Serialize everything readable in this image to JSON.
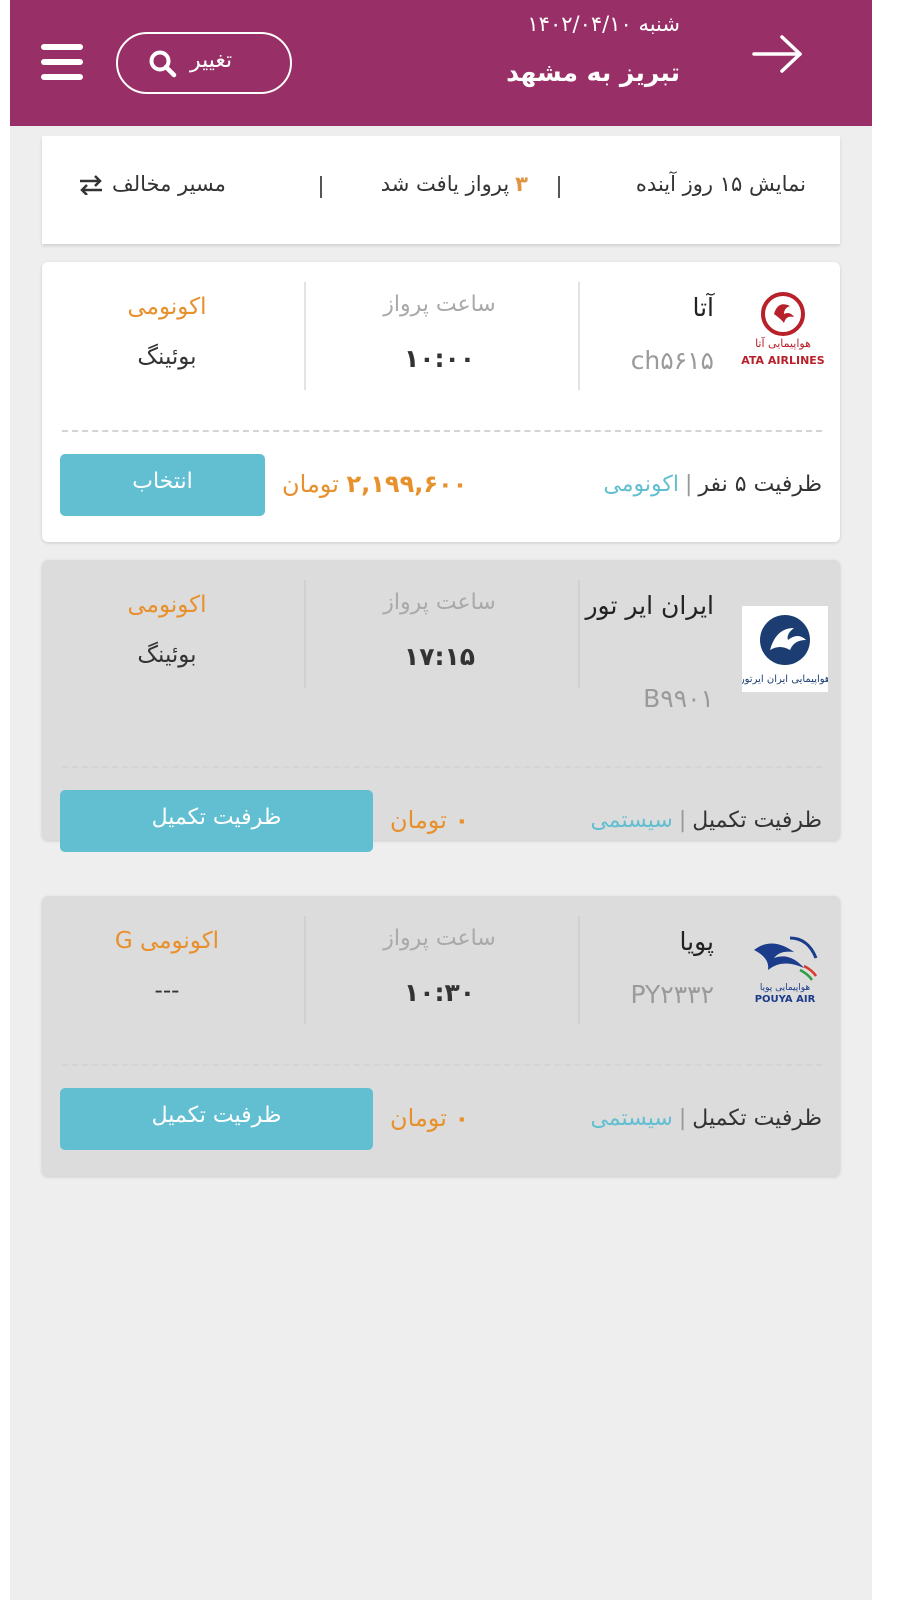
{
  "header": {
    "date": "شنبه ۱۴۰۲/۰۴/۱۰",
    "route": "تبریز به مشهد",
    "change_label": "تغییر",
    "icons": {
      "back": "arrow-right-icon",
      "search": "search-icon",
      "menu": "hamburger-menu-icon"
    },
    "bg_color": "#982f66"
  },
  "summary": {
    "days": "نمایش ۱۵ روز آینده",
    "count_number": "۳",
    "count_text": "پرواز یافت شد",
    "reverse_label": "مسیر مخالف"
  },
  "flights": [
    {
      "airline": "آتا",
      "flight_no": "ch۵۶۱۵",
      "logo": "ata-airlines-logo",
      "time_label": "ساعت پرواز",
      "time": "۱۰:۰۰",
      "class": "اکونومی",
      "aircraft": "بوئینگ",
      "capacity": "ظرفیت ۵ نفر",
      "capacity_class": "اکونومی",
      "price_amount": "۲,۱۹۹,۶۰۰",
      "currency": "تومان",
      "button_label": "انتخاب",
      "status": "available"
    },
    {
      "airline": "ایران ایر تور",
      "flight_no": "B۹۹۰۱",
      "logo": "iran-air-tour-logo",
      "time_label": "ساعت پرواز",
      "time": "۱۷:۱۵",
      "class": "اکونومی",
      "aircraft": "بوئینگ",
      "capacity": "ظرفیت تکمیل",
      "capacity_class": "سیستمی",
      "price_amount": "۰",
      "currency": "تومان",
      "button_label": "ظرفیت تکمیل",
      "status": "full"
    },
    {
      "airline": "پویا",
      "flight_no": "PY۲۳۳۲",
      "logo": "pouya-air-logo",
      "time_label": "ساعت پرواز",
      "time": "۱۰:۳۰",
      "class": "اکونومی G",
      "aircraft": "---",
      "capacity": "ظرفیت تکمیل",
      "capacity_class": "سیستمی",
      "price_amount": "۰",
      "currency": "تومان",
      "button_label": "ظرفیت تکمیل",
      "status": "full"
    }
  ],
  "colors": {
    "accent": "#62bfd2",
    "price": "#e8902b",
    "brand": "#982f66"
  }
}
